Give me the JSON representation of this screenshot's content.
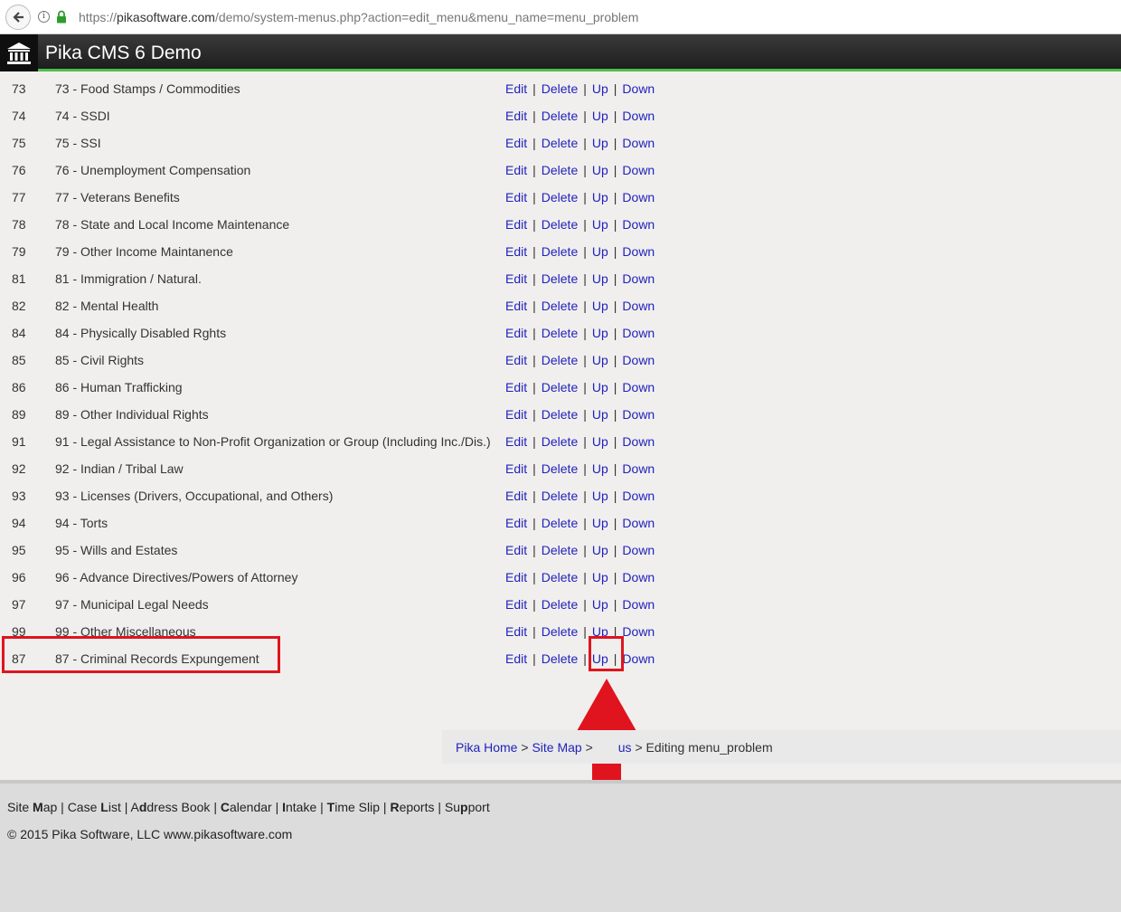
{
  "browser": {
    "url_prefix": "https://",
    "url_host": "pikasoftware.com",
    "url_path": "/demo/system-menus.php?action=edit_menu&menu_name=menu_problem"
  },
  "app": {
    "title": "Pika CMS 6 Demo"
  },
  "actions": {
    "edit": "Edit",
    "delete": "Delete",
    "up": "Up",
    "down": "Down",
    "sep": "|"
  },
  "rows": [
    {
      "value": "73",
      "label": "73 - Food Stamps / Commodities"
    },
    {
      "value": "74",
      "label": "74 - SSDI"
    },
    {
      "value": "75",
      "label": "75 - SSI"
    },
    {
      "value": "76",
      "label": "76 - Unemployment Compensation"
    },
    {
      "value": "77",
      "label": "77 - Veterans Benefits"
    },
    {
      "value": "78",
      "label": "78 - State and Local Income Maintenance"
    },
    {
      "value": "79",
      "label": "79 - Other Income Maintanence"
    },
    {
      "value": "81",
      "label": "81 - Immigration / Natural."
    },
    {
      "value": "82",
      "label": "82 - Mental Health"
    },
    {
      "value": "84",
      "label": "84 - Physically Disabled Rghts"
    },
    {
      "value": "85",
      "label": "85 - Civil Rights"
    },
    {
      "value": "86",
      "label": "86 - Human Trafficking"
    },
    {
      "value": "89",
      "label": "89 - Other Individual Rights"
    },
    {
      "value": "91",
      "label": "91 - Legal Assistance to Non-Profit Organization or Group (Including Inc./Dis.)"
    },
    {
      "value": "92",
      "label": "92 - Indian / Tribal Law"
    },
    {
      "value": "93",
      "label": "93 - Licenses (Drivers, Occupational, and Others)"
    },
    {
      "value": "94",
      "label": "94 - Torts"
    },
    {
      "value": "95",
      "label": "95 - Wills and Estates"
    },
    {
      "value": "96",
      "label": "96 - Advance Directives/Powers of Attorney"
    },
    {
      "value": "97",
      "label": "97 - Municipal Legal Needs"
    },
    {
      "value": "99",
      "label": "99 - Other Miscellaneous"
    },
    {
      "value": "87",
      "label": "87 - Criminal Records Expungement"
    }
  ],
  "breadcrumb": {
    "home": "Pika Home",
    "sitemap": "Site Map",
    "menus_partial": "us",
    "sep": ">",
    "current": "Editing menu_problem"
  },
  "footer": {
    "links": [
      {
        "pre": "Site ",
        "key": "M",
        "post": "ap"
      },
      {
        "pre": "Case ",
        "key": "L",
        "post": "ist"
      },
      {
        "pre": "A",
        "key": "d",
        "post": "dress Book"
      },
      {
        "pre": "",
        "key": "C",
        "post": "alendar"
      },
      {
        "pre": "",
        "key": "I",
        "post": "ntake"
      },
      {
        "pre": "",
        "key": "T",
        "post": "ime Slip"
      },
      {
        "pre": "",
        "key": "R",
        "post": "eports"
      },
      {
        "pre": "Su",
        "key": "p",
        "post": "port"
      }
    ],
    "copyright": "© 2015 Pika Software, LLC www.pikasoftware.com"
  },
  "colors": {
    "link": "#2222bb",
    "highlight": "#e0141e",
    "header_accent": "#4cc04a"
  }
}
